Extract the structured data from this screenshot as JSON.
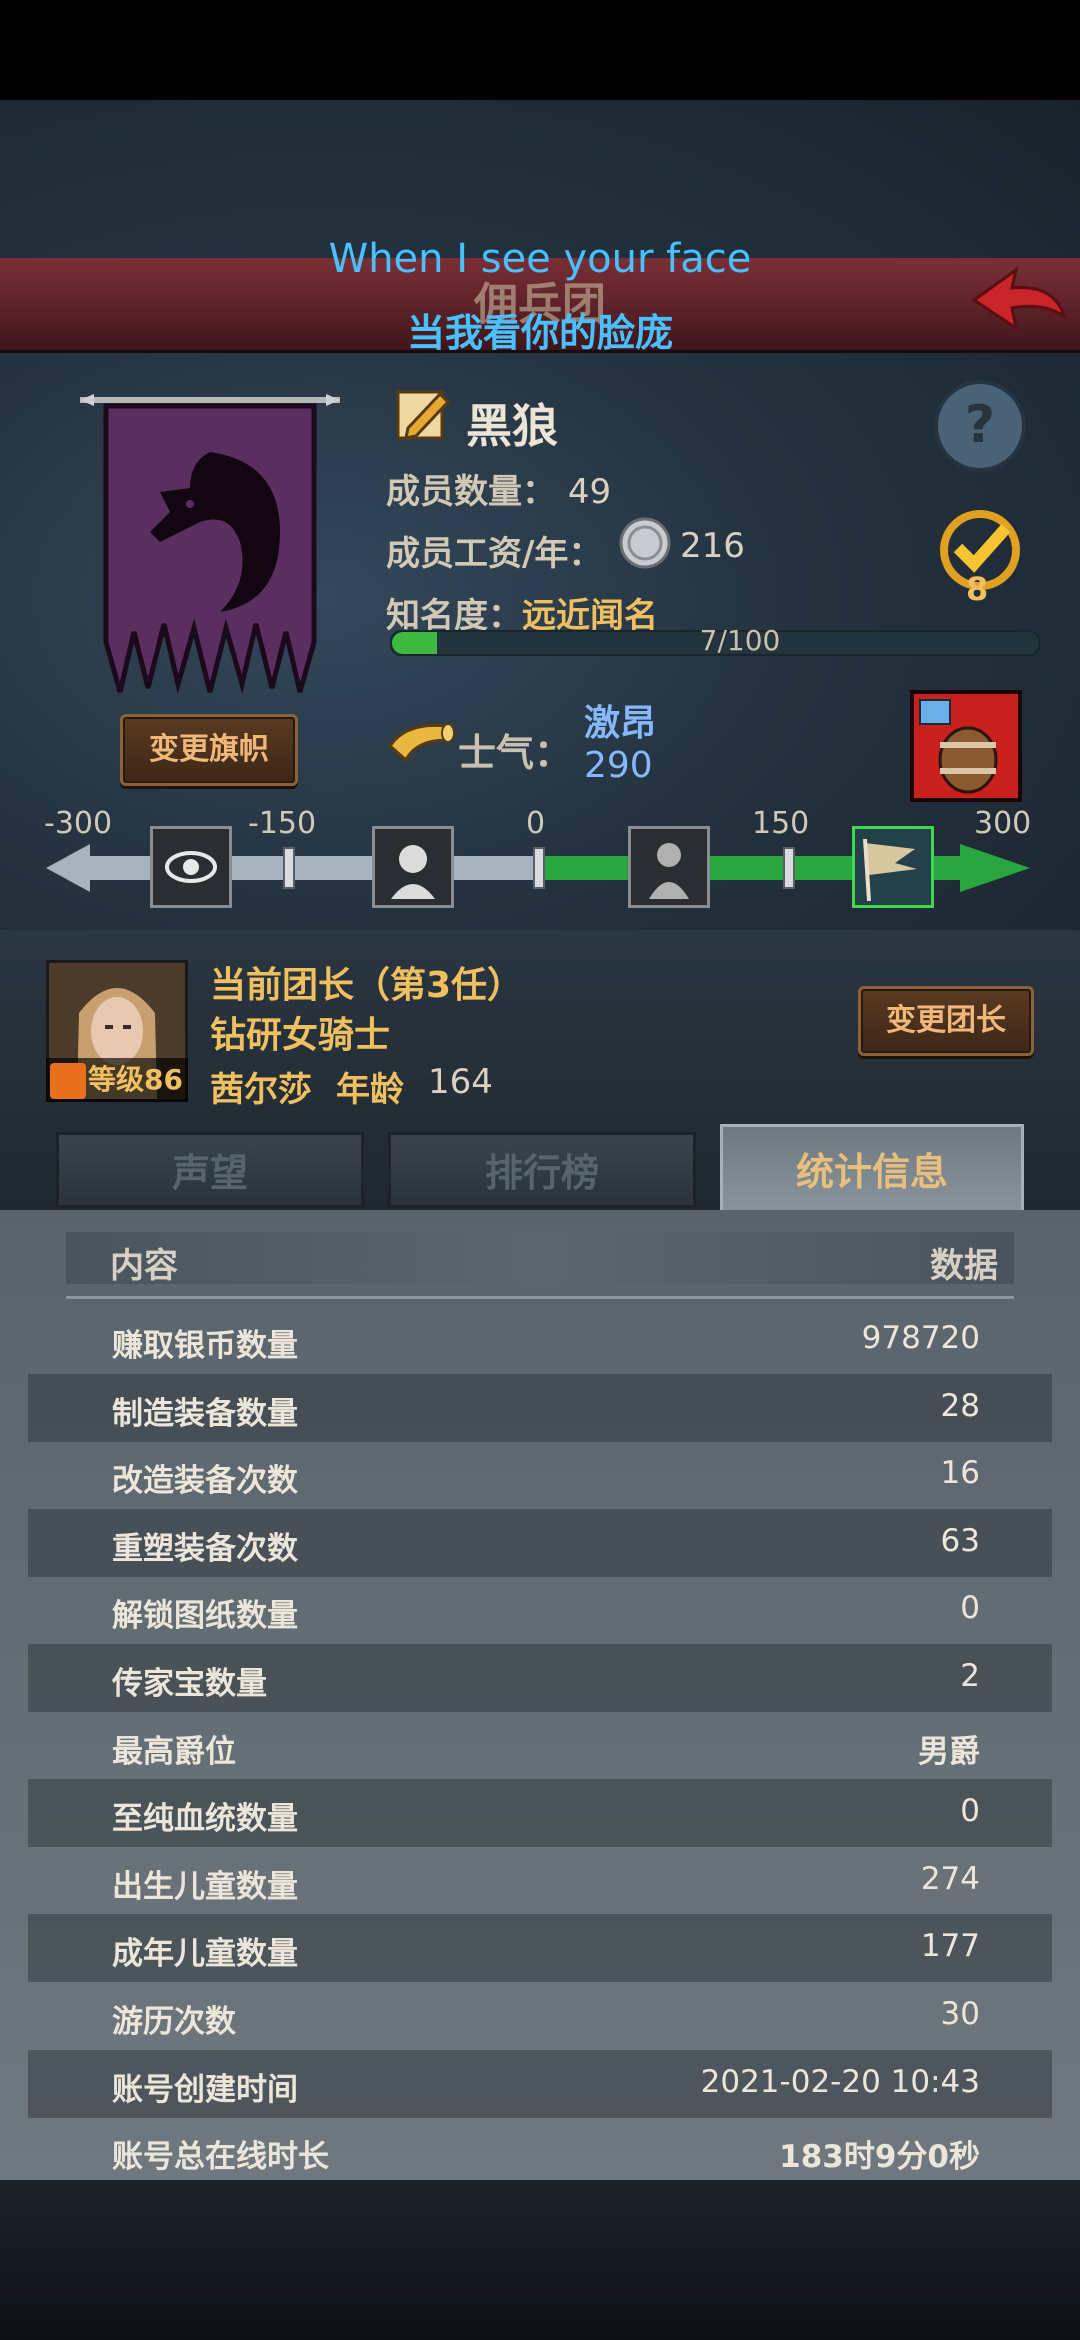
{
  "header": {
    "title": "佣兵团",
    "subtitle_en": "When I see your face",
    "subtitle_zh": "当我看你的脸庞"
  },
  "guild": {
    "name": "黑狼",
    "members_label": "成员数量：",
    "members_value": "49",
    "salary_label": "成员工资/年：",
    "salary_value": "216",
    "fame_label": "知名度：",
    "fame_value": "远近闻名",
    "fame_progress": 0.07,
    "fame_progress_text": "7/100",
    "change_flag_button": "变更旗帜",
    "task_count": "8"
  },
  "morale": {
    "label": "士气：",
    "state": "激昂",
    "value": "290",
    "ticks": [
      "-300",
      "-150",
      "0",
      "150",
      "300"
    ],
    "current": 290,
    "range": [
      -300,
      300
    ]
  },
  "leader": {
    "title": "当前团长（第3任）",
    "class": "钻研女骑士",
    "name": "茜尔莎",
    "age_label": "年龄",
    "age": "164",
    "level_label": "等级86",
    "change_button": "变更团长"
  },
  "tabs": [
    {
      "label": "声望"
    },
    {
      "label": "排行榜"
    },
    {
      "label": "统计信息"
    }
  ],
  "table": {
    "header_content": "内容",
    "header_data": "数据",
    "rows": [
      {
        "label": "赚取银币数量",
        "value": "978720"
      },
      {
        "label": "制造装备数量",
        "value": "28"
      },
      {
        "label": "改造装备次数",
        "value": "16"
      },
      {
        "label": "重塑装备次数",
        "value": "63"
      },
      {
        "label": "解锁图纸数量",
        "value": "0"
      },
      {
        "label": "传家宝数量",
        "value": "2"
      },
      {
        "label": "最高爵位",
        "value": "男爵"
      },
      {
        "label": "至纯血统数量",
        "value": "0"
      },
      {
        "label": "出生儿童数量",
        "value": "274"
      },
      {
        "label": "成年儿童数量",
        "value": "177"
      },
      {
        "label": "游历次数",
        "value": "30"
      },
      {
        "label": "账号创建时间",
        "value": "2021-02-20 10:43"
      },
      {
        "label": "账号总在线时长",
        "value": "183时9分0秒"
      }
    ]
  },
  "colors": {
    "accent_gold": "#f0c060",
    "morale_blue": "#86b8ff",
    "progress_green": "#3fb840",
    "title_red": "#6a282e",
    "subtitle_cyan": "#49c0ff"
  }
}
